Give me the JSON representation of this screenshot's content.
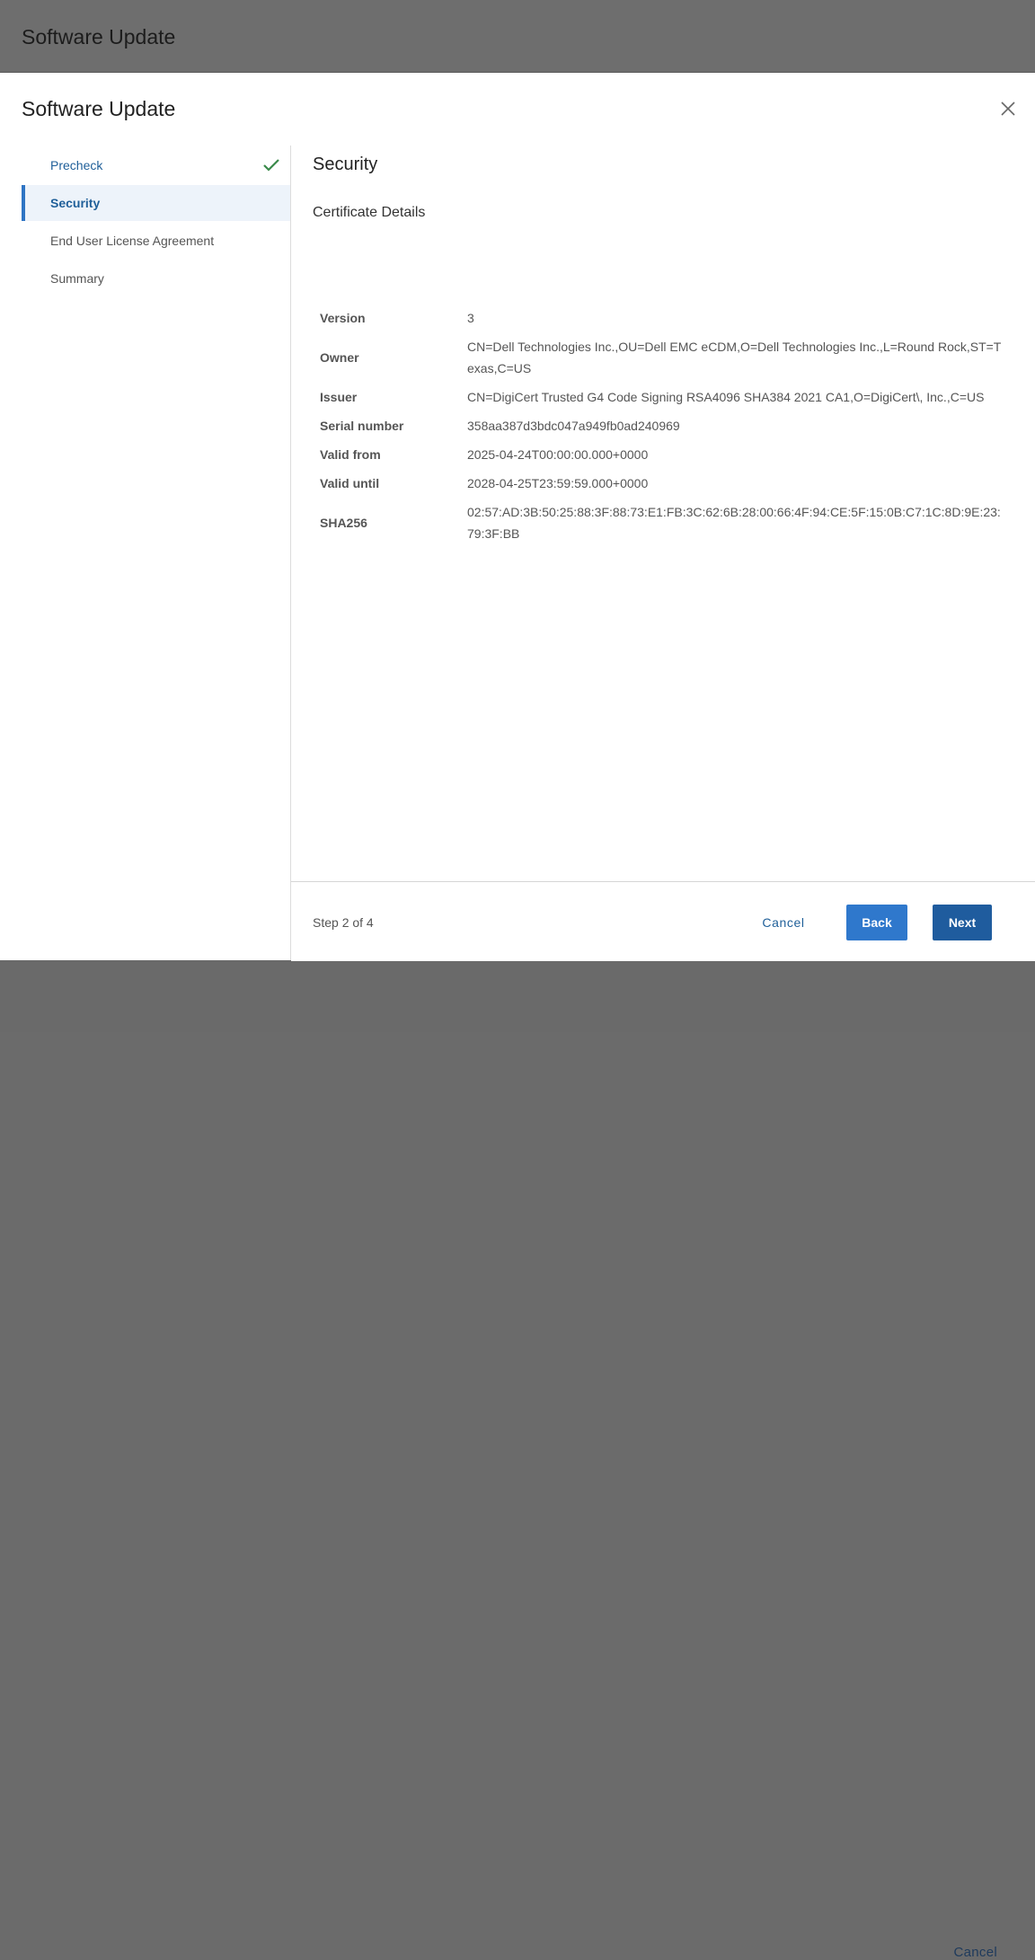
{
  "background": {
    "title": "Software Update",
    "cancel_label": "Cancel"
  },
  "dialog": {
    "title": "Software Update",
    "steps": [
      {
        "label": "Precheck",
        "state": "done"
      },
      {
        "label": "Security",
        "state": "active"
      },
      {
        "label": "End User License Agreement",
        "state": "pending"
      },
      {
        "label": "Summary",
        "state": "pending"
      }
    ],
    "main": {
      "title": "Security",
      "section_title": "Certificate Details",
      "details": [
        {
          "key": "Version",
          "value": "3"
        },
        {
          "key": "Owner",
          "value": "CN=Dell Technologies Inc.,OU=Dell EMC eCDM,O=Dell Technologies Inc.,L=Round Rock,ST=Texas,C=US"
        },
        {
          "key": "Issuer",
          "value": "CN=DigiCert Trusted G4 Code Signing RSA4096 SHA384 2021 CA1,O=DigiCert\\, Inc.,C=US"
        },
        {
          "key": "Serial number",
          "value": "358aa387d3bdc047a949fb0ad240969"
        },
        {
          "key": "Valid from",
          "value": "2025-04-24T00:00:00.000+0000"
        },
        {
          "key": "Valid until",
          "value": "2028-04-25T23:59:59.000+0000"
        },
        {
          "key": "SHA256",
          "value": "02:57:AD:3B:50:25:88:3F:88:73:E1:FB:3C:62:6B:28:00:66:4F:94:CE:5F:15:0B:C7:1C:8D:9E:23:79:3F:BB"
        }
      ]
    },
    "footer": {
      "step_count": "Step 2 of 4",
      "cancel_label": "Cancel",
      "back_label": "Back",
      "next_label": "Next"
    }
  },
  "colors": {
    "accent": "#2f78cc",
    "primary_dark": "#1f5c9e",
    "check": "#3a8a4a",
    "active_bg": "#edf3fa"
  },
  "icons": {
    "close": "close-icon",
    "check": "check-icon"
  }
}
